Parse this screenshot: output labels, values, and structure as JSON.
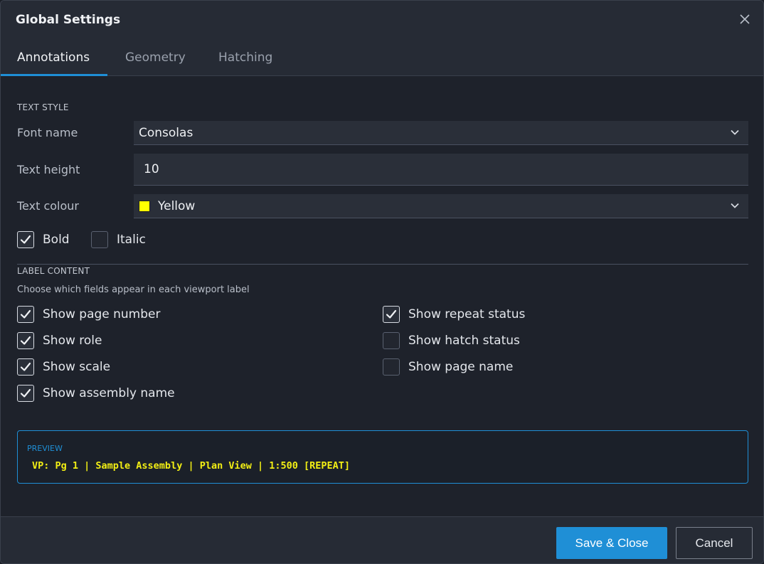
{
  "dialog": {
    "title": "Global Settings"
  },
  "tabs": [
    {
      "label": "Annotations",
      "active": true
    },
    {
      "label": "Geometry",
      "active": false
    },
    {
      "label": "Hatching",
      "active": false
    }
  ],
  "text_style": {
    "heading": "TEXT STYLE",
    "font_name": {
      "label": "Font name",
      "value": "Consolas"
    },
    "text_height": {
      "label": "Text height",
      "value": "10"
    },
    "text_colour": {
      "label": "Text colour",
      "value": "Yellow",
      "swatch_color": "#ffff00"
    },
    "bold": {
      "label": "Bold",
      "checked": true
    },
    "italic": {
      "label": "Italic",
      "checked": false
    }
  },
  "label_content": {
    "heading": "LABEL CONTENT",
    "hint": "Choose which fields appear in each viewport label",
    "left": [
      {
        "label": "Show page number",
        "checked": true
      },
      {
        "label": "Show role",
        "checked": true
      },
      {
        "label": "Show scale",
        "checked": true
      },
      {
        "label": "Show assembly name",
        "checked": true
      }
    ],
    "right": [
      {
        "label": "Show repeat status",
        "checked": true
      },
      {
        "label": "Show hatch status",
        "checked": false
      },
      {
        "label": "Show page name",
        "checked": false
      }
    ]
  },
  "preview": {
    "heading": "PREVIEW",
    "text": "VP: Pg 1 | Sample Assembly | Plan View | 1:500 [REPEAT]",
    "text_color": "#f2ee14"
  },
  "footer": {
    "primary_label": "Save & Close",
    "secondary_label": "Cancel"
  },
  "colors": {
    "accent": "#1f8fd6"
  },
  "icons": {
    "close": "close-icon",
    "dropdown": "chevron-down-icon",
    "check": "checkmark-icon"
  }
}
